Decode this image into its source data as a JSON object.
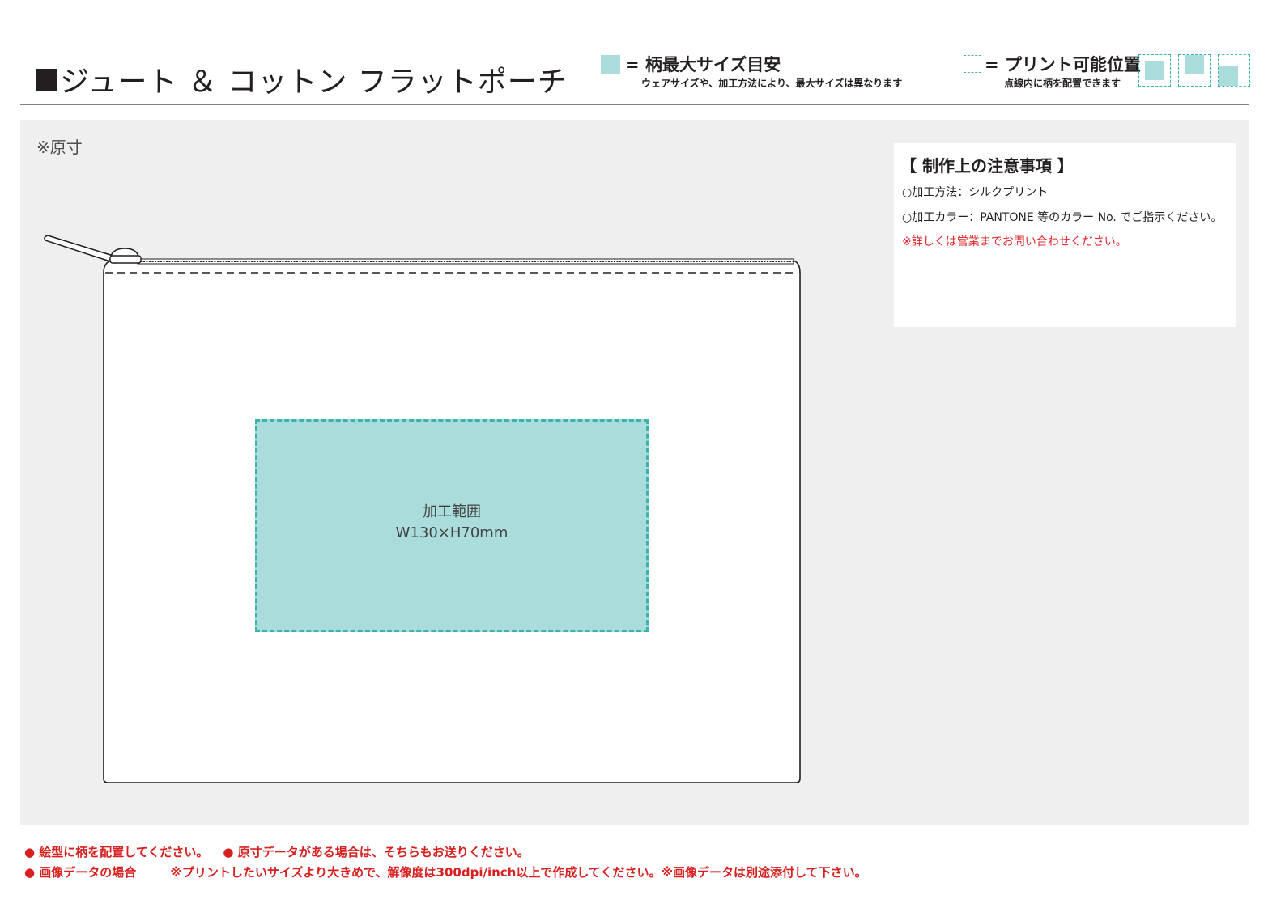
{
  "header": {
    "title_mark": "■",
    "title": "ジュート ＆ コットン フラットポーチ"
  },
  "legend": {
    "max_size": {
      "head": "= 柄最大サイズ目安",
      "sub": "ウェアサイズや、加工方法により、最大サイズは異なります"
    },
    "print_position": {
      "head": "= プリント可能位置",
      "sub": "点線内に柄を配置できます"
    }
  },
  "canvas": {
    "scale_note": "※原寸",
    "print_area": {
      "label": "加工範囲",
      "size": "W130×H70mm"
    }
  },
  "notes": {
    "title": "【 制作上の注意事項 】",
    "method": "○加工方法：シルクプリント",
    "color": "○加工カラー：PANTONE 等のカラー No. でご指示ください。",
    "contact": "※詳しくは営業までお問い合わせください。"
  },
  "footer": {
    "line1_a": "● 絵型に柄を配置してください。",
    "line1_b": "● 原寸データがある場合は、そちらもお送りください。",
    "line2_a": "● 画像データの場合",
    "line2_b": "※プリントしたいサイズより大きめで、解像度は300dpi/inch以上で作成してください。※画像データは別途添付して下さい。"
  },
  "colors": {
    "fill_swatch": "#a9dcdb",
    "dash_line": "#39b3ae",
    "note_red": "#e0262b",
    "panel_bg": "#eeefee"
  }
}
